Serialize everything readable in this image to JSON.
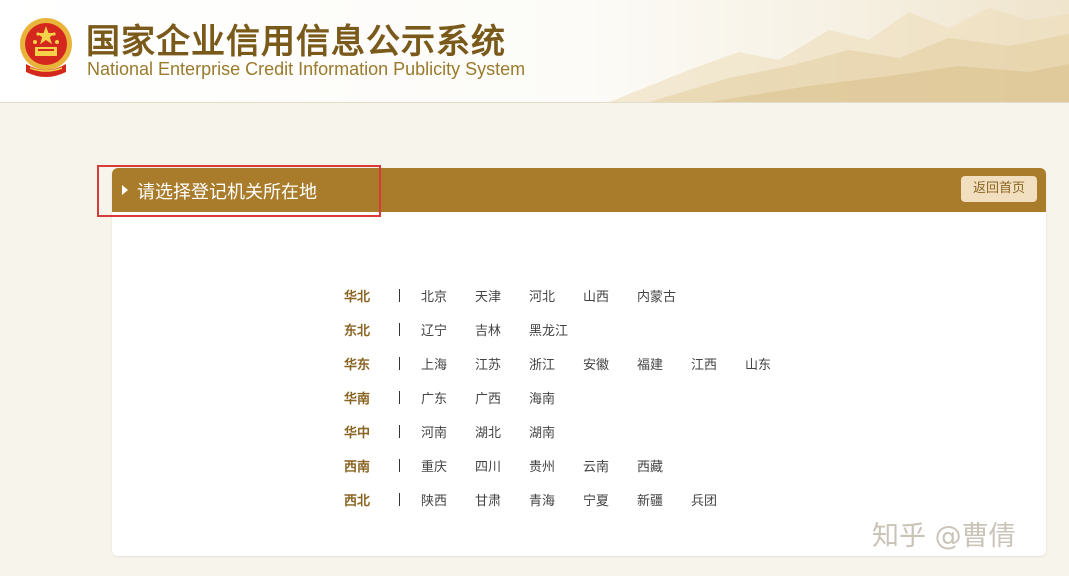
{
  "header": {
    "title_cn": "国家企业信用信息公示系统",
    "title_en": "National Enterprise Credit Information Publicity System",
    "emblem_icon": "national-emblem-icon"
  },
  "panel": {
    "title": "请选择登记机关所在地",
    "back_button": "返回首页"
  },
  "regions": [
    {
      "name": "华北",
      "provinces": [
        "北京",
        "天津",
        "河北",
        "山西",
        "内蒙古"
      ]
    },
    {
      "name": "东北",
      "provinces": [
        "辽宁",
        "吉林",
        "黑龙江"
      ]
    },
    {
      "name": "华东",
      "provinces": [
        "上海",
        "江苏",
        "浙江",
        "安徽",
        "福建",
        "江西",
        "山东"
      ]
    },
    {
      "name": "华南",
      "provinces": [
        "广东",
        "广西",
        "海南"
      ]
    },
    {
      "name": "华中",
      "provinces": [
        "河南",
        "湖北",
        "湖南"
      ]
    },
    {
      "name": "西南",
      "provinces": [
        "重庆",
        "四川",
        "贵州",
        "云南",
        "西藏"
      ]
    },
    {
      "name": "西北",
      "provinces": [
        "陕西",
        "甘肃",
        "青海",
        "宁夏",
        "新疆",
        "兵团"
      ]
    }
  ],
  "watermark": "知乎 @曹倩",
  "colors": {
    "accent": "#a97c2c",
    "title": "#7a5a1a",
    "region_label": "#8a6422",
    "highlight": "#d93a3a",
    "background": "#f7f4ec"
  }
}
